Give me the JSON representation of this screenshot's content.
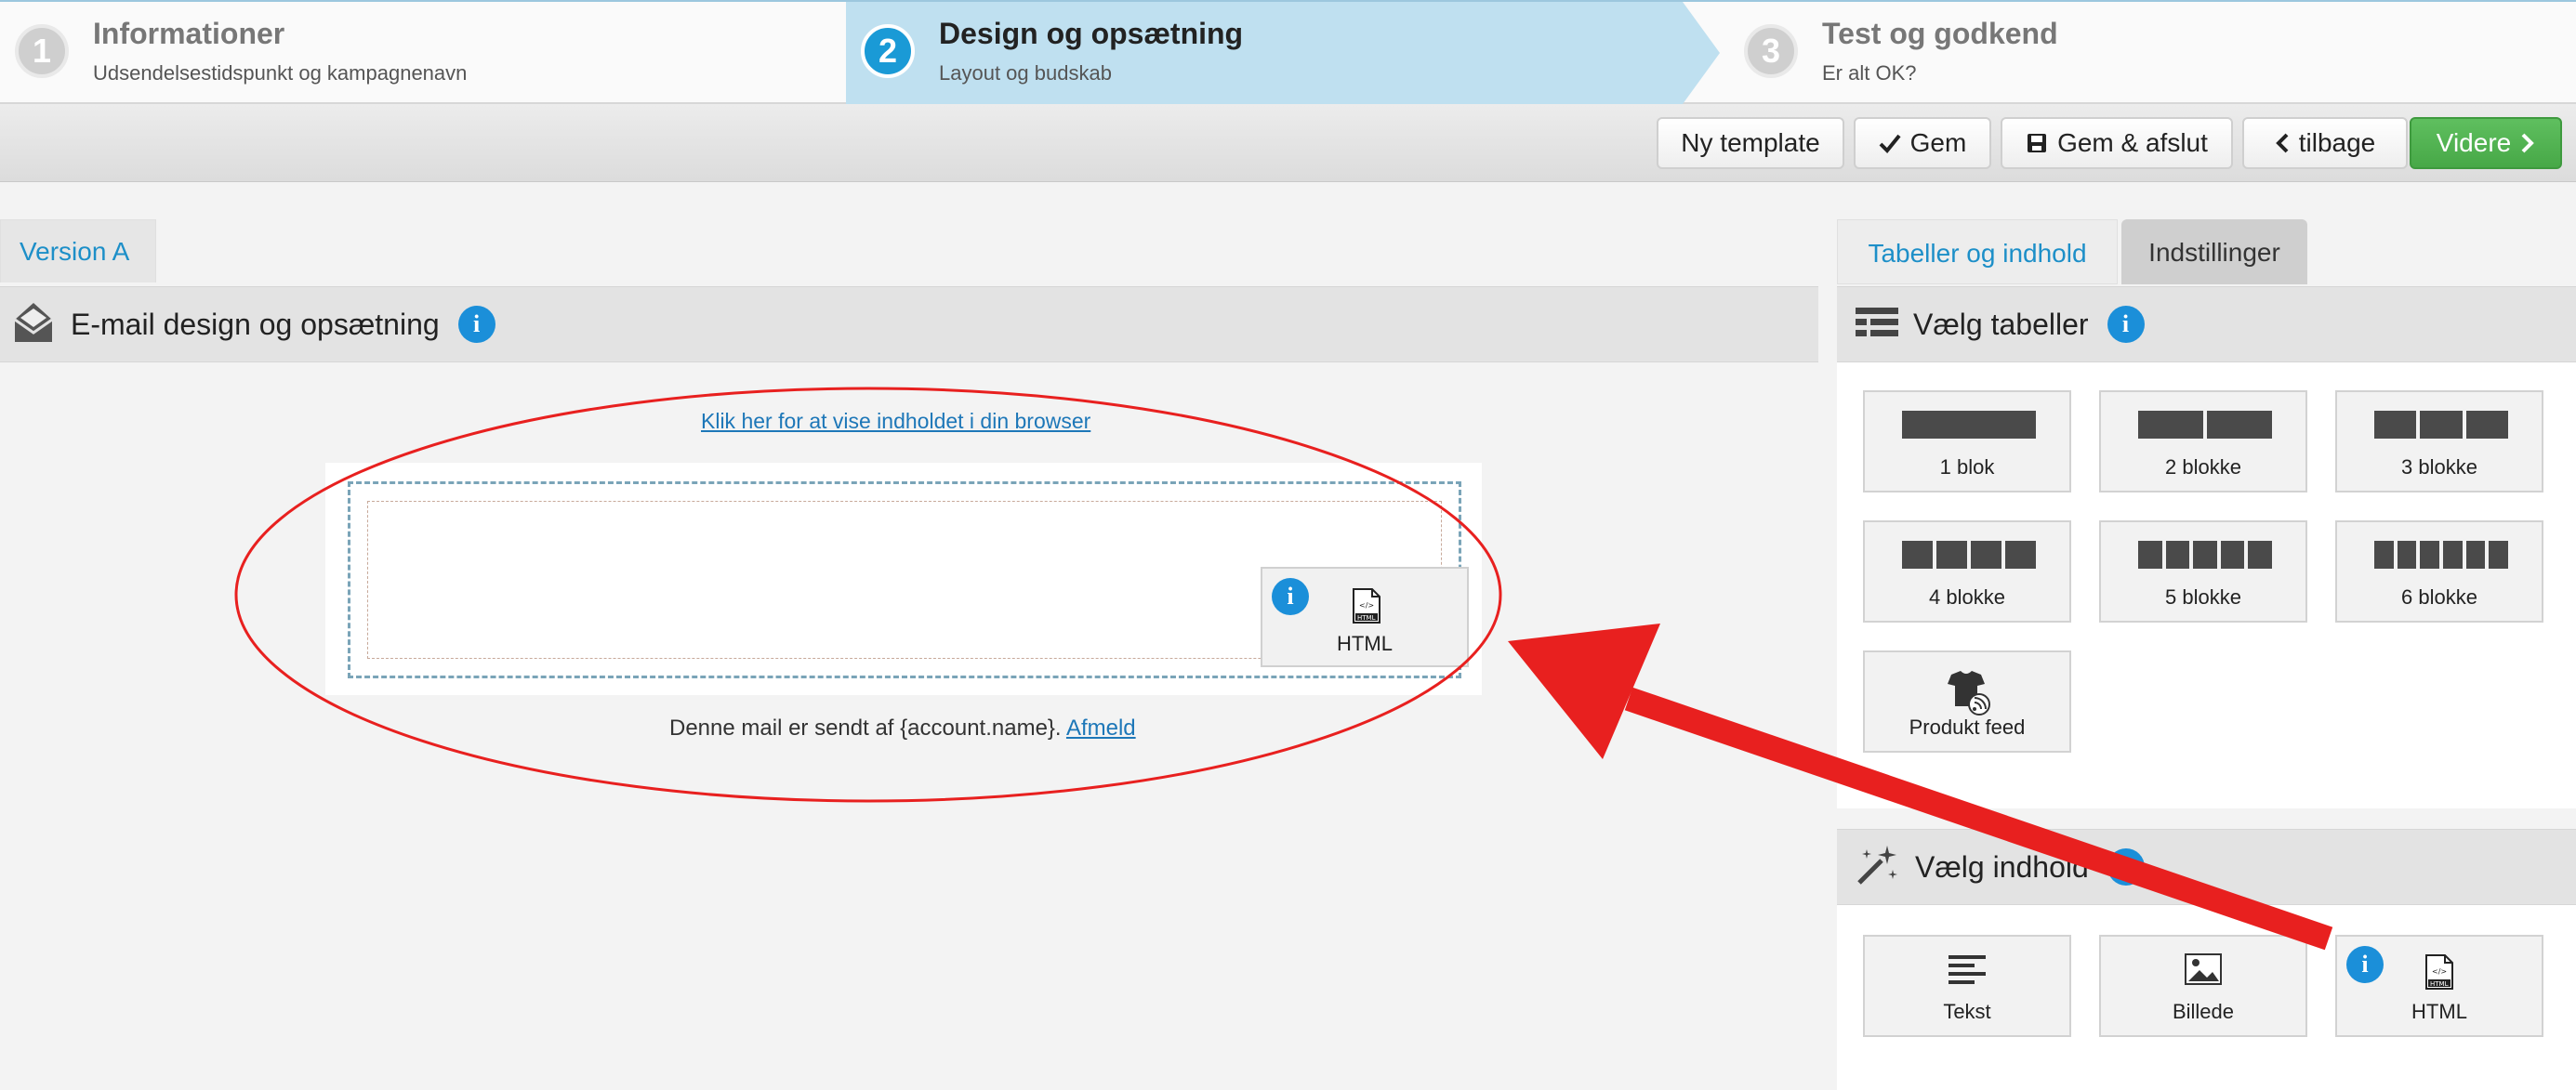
{
  "wizard": {
    "steps": [
      {
        "num": "1",
        "title": "Informationer",
        "sub": "Udsendelsestidspunkt og kampagnenavn"
      },
      {
        "num": "2",
        "title": "Design og opsætning",
        "sub": "Layout og budskab"
      },
      {
        "num": "3",
        "title": "Test og godkend",
        "sub": "Er alt OK?"
      }
    ]
  },
  "toolbar": {
    "new_template": "Ny template",
    "save": "Gem",
    "save_close": "Gem & afslut",
    "back": "tilbage",
    "next": "Videre"
  },
  "editor": {
    "version_tab": "Version A",
    "section_title": "E-mail design og opsætning",
    "browser_link": "Klik her for at vise indholdet i din browser",
    "dropped_block": "HTML",
    "footer_text": "Denne mail er sendt af {account.name}.",
    "unsubscribe": "Afmeld"
  },
  "sidebar": {
    "tabs": [
      "Tabeller og indhold",
      "Indstillinger"
    ],
    "tables_title": "Vælg tabeller",
    "tables": [
      {
        "label": "1 blok",
        "blocks": 1
      },
      {
        "label": "2 blokke",
        "blocks": 2
      },
      {
        "label": "3 blokke",
        "blocks": 3
      },
      {
        "label": "4 blokke",
        "blocks": 4
      },
      {
        "label": "5 blokke",
        "blocks": 5
      },
      {
        "label": "6 blokke",
        "blocks": 6
      },
      {
        "label": "Produkt feed",
        "blocks": 0
      }
    ],
    "content_title": "Vælg indhold",
    "content": [
      {
        "label": "Tekst",
        "icon": "text-lines-icon"
      },
      {
        "label": "Billede",
        "icon": "image-icon"
      },
      {
        "label": "HTML",
        "icon": "html-file-icon"
      }
    ]
  },
  "info_glyph": "i",
  "colors": {
    "accent_blue": "#1b8fd9",
    "active_step": "#bfe0f0",
    "next_green": "#47a847",
    "annotation_red": "#e8201f"
  }
}
